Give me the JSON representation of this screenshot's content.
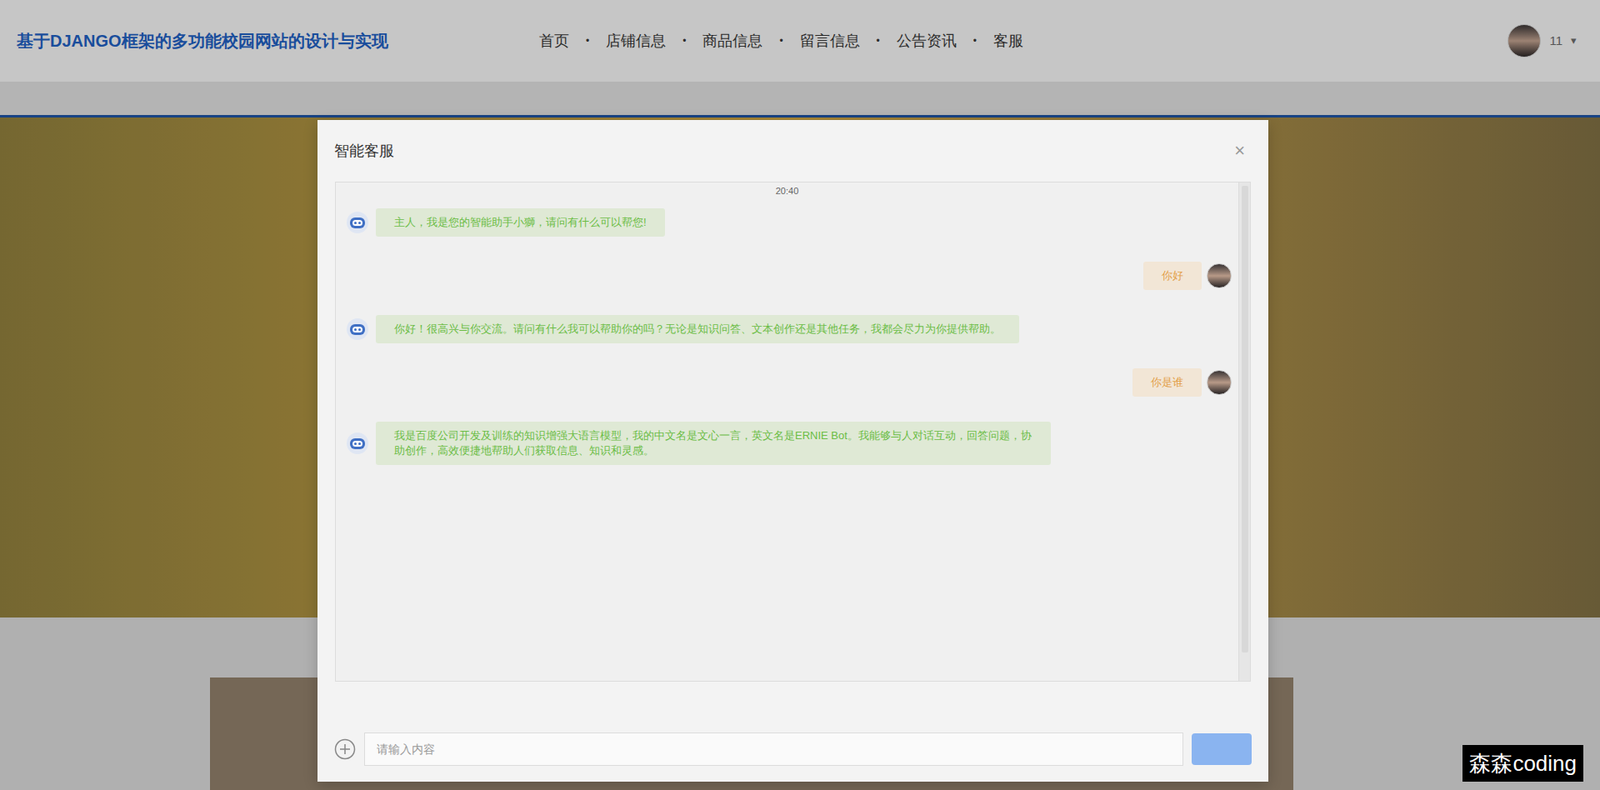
{
  "header": {
    "title": "基于DJANGO框架的多功能校园网站的设计与实现",
    "nav": [
      {
        "label": "首页"
      },
      {
        "label": "店铺信息"
      },
      {
        "label": "商品信息"
      },
      {
        "label": "留言信息"
      },
      {
        "label": "公告资讯"
      },
      {
        "label": "客服"
      }
    ],
    "separator": "•",
    "user": {
      "name": "11",
      "caret": "▾"
    }
  },
  "chat_dialog": {
    "title": "智能客服",
    "close": "×",
    "time": "20:40",
    "messages": [
      {
        "sender": "bot",
        "text": "主人，我是您的智能助手小獅，请问有什么可以帮您!"
      },
      {
        "sender": "user",
        "text": "你好"
      },
      {
        "sender": "bot",
        "text": "你好！很高兴与你交流。请问有什么我可以帮助你的吗？无论是知识问答、文本创作还是其他任务，我都会尽力为你提供帮助。"
      },
      {
        "sender": "user",
        "text": "你是谁"
      },
      {
        "sender": "bot",
        "text": "我是百度公司开发及训练的知识增强大语言模型，我的中文名是文心一言，英文名是ERNIE Bot。我能够与人对话互动，回答问题，协助创作，高效便捷地帮助人们获取信息、知识和灵感。"
      }
    ],
    "input": {
      "placeholder": "请输入内容"
    }
  },
  "watermark": "森森coding"
}
